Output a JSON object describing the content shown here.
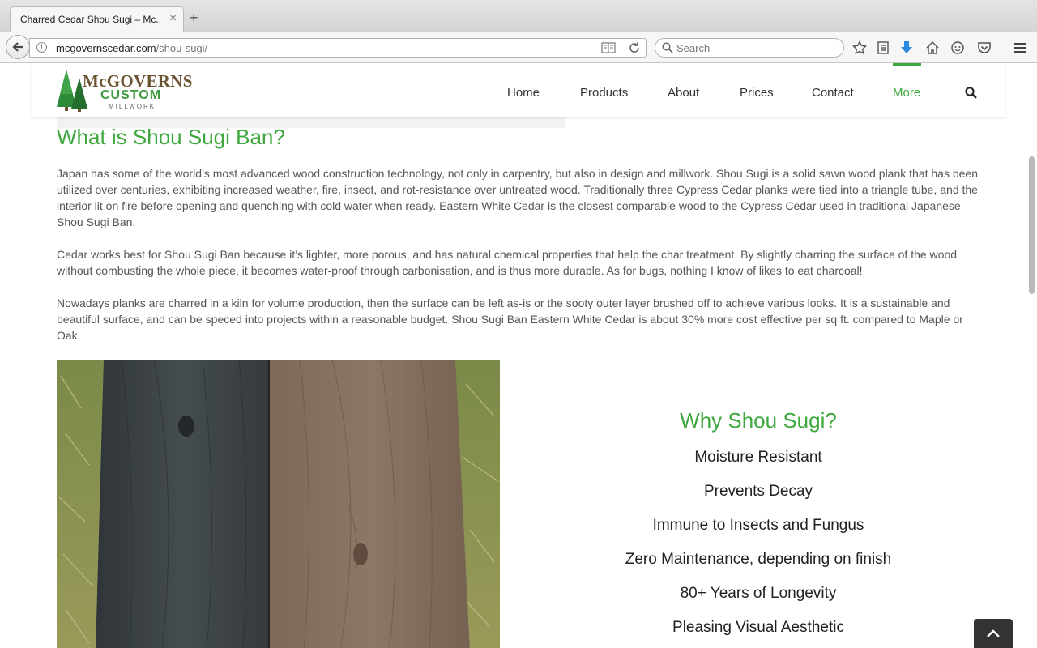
{
  "browser": {
    "tab_title": "Charred Cedar Shou Sugi – Mc...",
    "close_glyph": "×",
    "new_tab_glyph": "+",
    "url_domain": "mcgovernscedar.com",
    "url_path": "/shou-sugi/",
    "search_placeholder": "Search",
    "info_glyph": "i"
  },
  "site": {
    "logo": {
      "title": "McGOVERNS",
      "subtitle": "CUSTOM",
      "tagline": "MILLWORK"
    },
    "nav": [
      {
        "label": "Home"
      },
      {
        "label": "Products"
      },
      {
        "label": "About"
      },
      {
        "label": "Prices"
      },
      {
        "label": "Contact"
      },
      {
        "label": "More"
      }
    ],
    "accent_color": "#3ea83e"
  },
  "content": {
    "heading": "What is Shou Sugi Ban?",
    "paragraphs": [
      "Japan has some of the world’s most advanced wood construction technology, not only in carpentry, but also in design and millwork. Shou Sugi is a solid sawn wood plank that has been utilized over centuries, exhibiting increased weather, fire, insect, and rot-resistance over untreated wood. Traditionally three Cypress Cedar planks were tied into a triangle tube, and the interior lit on fire before opening and quenching with cold water when ready. Eastern White Cedar is the closest comparable wood to the Cypress Cedar used in traditional Japanese Shou Sugi Ban.",
      "Cedar works best for Shou Sugi Ban because it’s lighter, more porous, and has natural chemical properties that help the char treatment. By slightly charring the surface of the wood without combusting the whole piece, it becomes water-proof through carbonisation, and is thus more durable. As for bugs, nothing I know of likes to eat charcoal!",
      "Nowadays planks are charred in a kiln for volume production, then the surface can be left as-is or the sooty outer layer brushed off to achieve various looks. It is a sustainable and beautiful surface, and can be speced into projects within a reasonable budget. Shou Sugi Ban Eastern White Cedar is about 30% more cost effective per sq ft. compared to Maple or Oak."
    ],
    "why_title": "Why Shou Sugi?",
    "why_items": [
      "Moisture Resistant",
      "Prevents Decay",
      "Immune to Insects and Fungus",
      "Zero Maintenance, depending on finish",
      "80+ Years of Longevity",
      "Pleasing Visual Aesthetic"
    ]
  }
}
